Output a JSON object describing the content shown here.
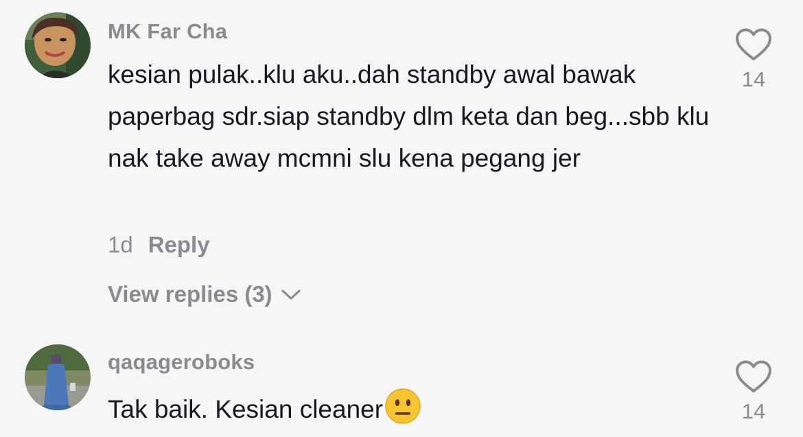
{
  "comments": [
    {
      "username": "MK Far Cha",
      "text": "kesian pulak..klu aku..dah standby awal bawak paperbag sdr.siap standby dlm keta dan beg...sbb klu nak take away mcmni slu kena pegang jer",
      "time": "1d",
      "reply_label": "Reply",
      "view_replies_label": "View replies (3)",
      "like_count": "14",
      "avatar_icon": "profile-photo-woman-smiling"
    },
    {
      "username": "qaqageroboks",
      "text": "Tak baik. Kesian cleaner",
      "emoji": "neutral-face-emoji",
      "like_count": "14",
      "avatar_icon": "profile-photo-person-outdoors"
    }
  ],
  "colors": {
    "background": "#f6f6f6",
    "primary_text": "#161823",
    "secondary_text": "#8a8b91"
  }
}
